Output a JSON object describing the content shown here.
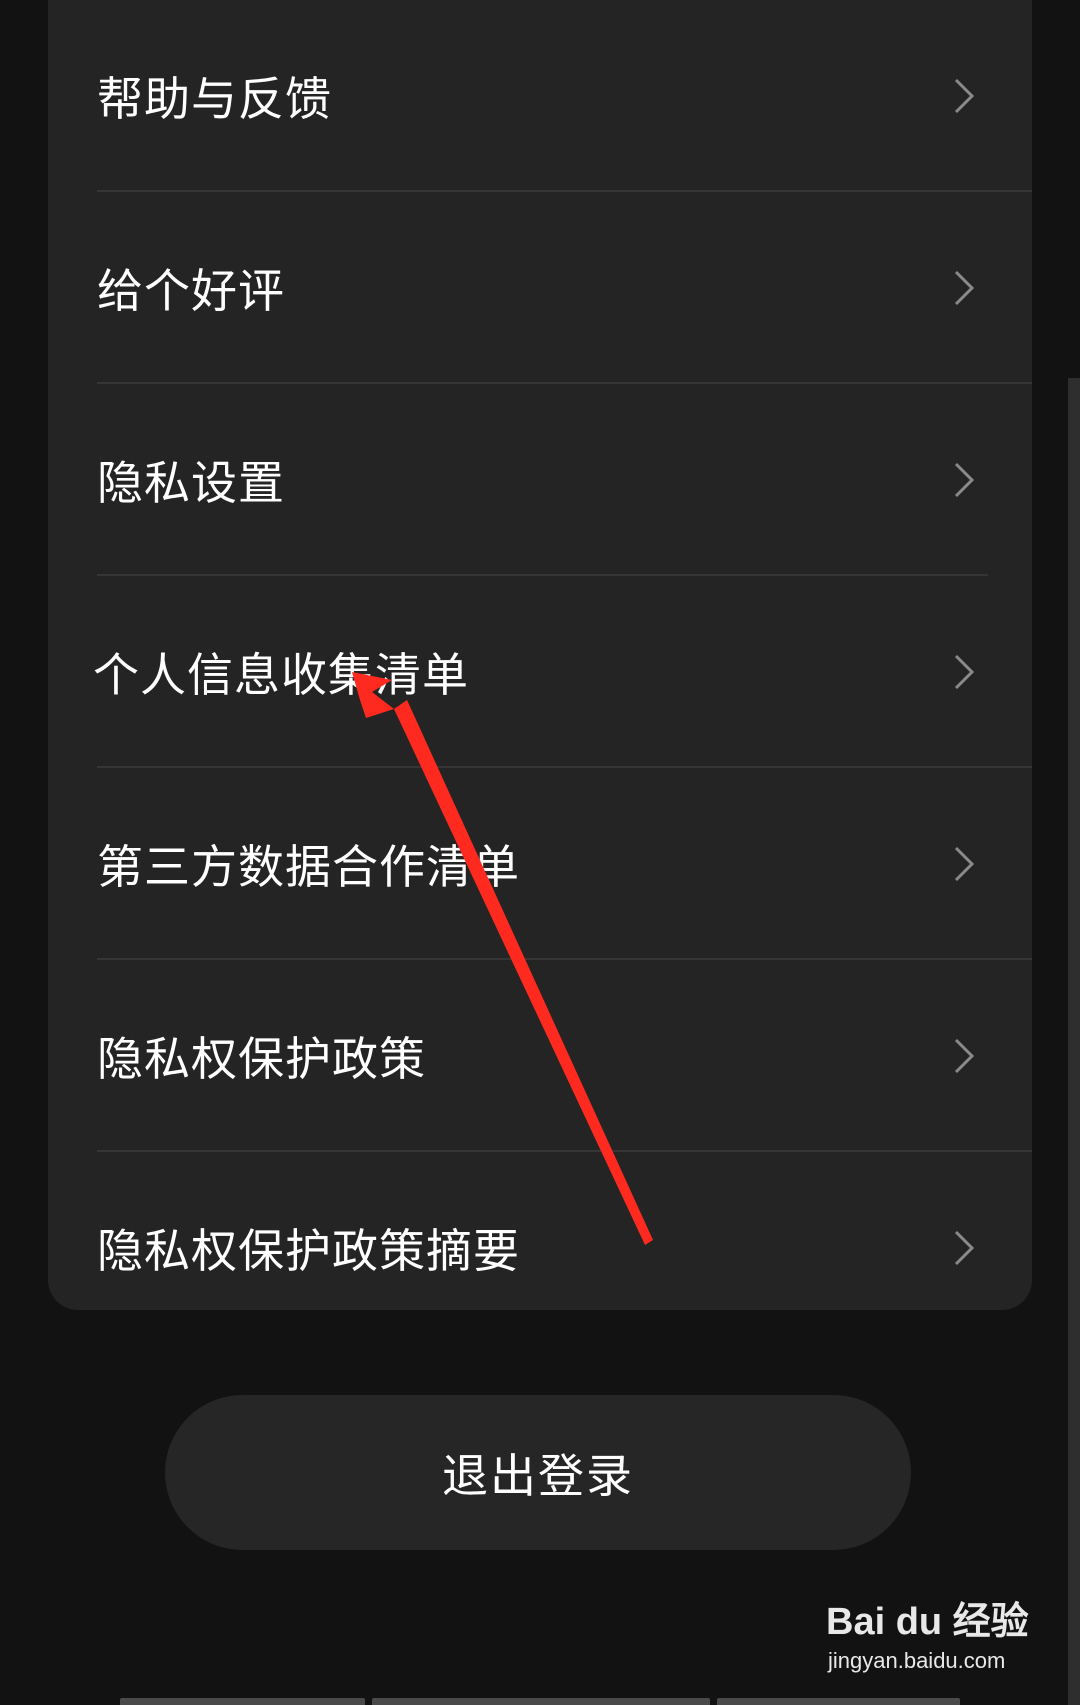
{
  "menu": {
    "items": [
      {
        "label": "帮助与反馈"
      },
      {
        "label": "给个好评"
      },
      {
        "label": "隐私设置"
      },
      {
        "label": "个人信息收集清单"
      },
      {
        "label": "第三方数据合作清单"
      },
      {
        "label": "隐私权保护政策"
      },
      {
        "label": "隐私权保护政策摘要"
      }
    ]
  },
  "logout": {
    "label": "退出登录"
  },
  "watermark": {
    "brand": "Bai du 经验",
    "url": "jingyan.baidu.com"
  },
  "annotation": {
    "arrow_color": "#ff2a1f",
    "target": "个人信息收集清单"
  },
  "colors": {
    "background": "#121212",
    "card": "#242424",
    "divider": "#353535",
    "text": "#ffffff",
    "chevron": "#8a8a8a"
  }
}
